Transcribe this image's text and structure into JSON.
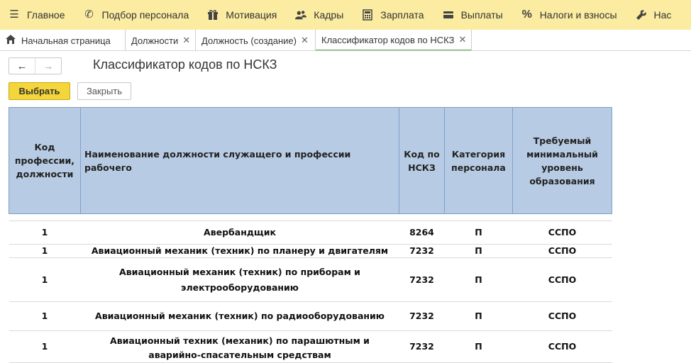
{
  "menu": [
    {
      "icon": "hamburger-icon",
      "glyph": "☰",
      "label": "Главное"
    },
    {
      "icon": "phone-icon",
      "glyph": "✆",
      "label": "Подбор персонала"
    },
    {
      "icon": "gift-icon",
      "glyph": "▦",
      "label": "Мотивация"
    },
    {
      "icon": "people-icon",
      "glyph": "☗",
      "label": "Кадры"
    },
    {
      "icon": "calculator-icon",
      "glyph": "▦",
      "label": "Зарплата"
    },
    {
      "icon": "wallet-icon",
      "glyph": "▬",
      "label": "Выплаты"
    },
    {
      "icon": "percent-icon",
      "glyph": "%",
      "label": "Налоги и взносы"
    },
    {
      "icon": "wrench-icon",
      "glyph": "✎",
      "label": "Нас"
    }
  ],
  "tabs": [
    {
      "label": "Начальная страница",
      "home": true,
      "closable": false
    },
    {
      "label": "Должности",
      "home": false,
      "closable": true
    },
    {
      "label": "Должность (создание)",
      "home": false,
      "closable": true
    },
    {
      "label": "Классификатор кодов по НСКЗ",
      "home": false,
      "closable": true,
      "active": true
    }
  ],
  "form": {
    "back_glyph": "←",
    "forward_glyph": "→",
    "title": "Классификатор кодов по НСКЗ",
    "select_label": "Выбрать",
    "close_label": "Закрыть"
  },
  "table": {
    "headers": [
      "Код профессии, должности",
      "Наименование должности служащего и профессии рабочего",
      "Код по НСКЗ",
      "Категория персонала",
      "Требуемый минимальный уровень образования"
    ],
    "rows": [
      {
        "code": "1",
        "name": "Авербандщик",
        "nskz": "8264",
        "category": "П",
        "education": "ССПО"
      },
      {
        "code": "1",
        "name": "Авиационный механик (техник) по планеру и двигателям",
        "nskz": "7232",
        "category": "П",
        "education": "ССПО"
      },
      {
        "code": "1",
        "name_line1": "Авиационный механик (техник) по приборам и",
        "name_line2": "электрооборудованию",
        "nskz": "7232",
        "category": "П",
        "education": "ССПО"
      },
      {
        "code": "1",
        "name": "Авиационный механик (техник) по радиооборудованию",
        "nskz": "7232",
        "category": "П",
        "education": "ССПО"
      },
      {
        "code": "1",
        "name_line1": "Авиационный техник (механик) по парашютным и",
        "name_line2": "аварийно-спасательным средствам",
        "nskz": "7232",
        "category": "П",
        "education": "ССПО"
      }
    ]
  }
}
